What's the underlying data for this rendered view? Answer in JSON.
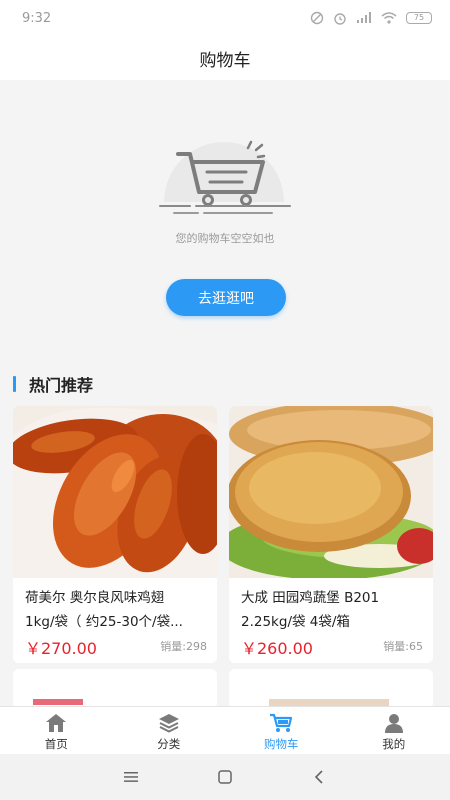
{
  "status_bar": {
    "time": "9:32",
    "battery_level": "75"
  },
  "header": {
    "title": "购物车"
  },
  "empty_cart": {
    "message": "您的购物车空空如也",
    "button_label": "去逛逛吧"
  },
  "recommend": {
    "title": "热门推荐",
    "products": [
      {
        "name_line1": "荷美尔 奥尔良风味鸡翅",
        "name_line2": "1kg/袋（ 约25-30个/袋...",
        "price": "￥270.00",
        "sales": "销量:298",
        "image": "roasted-chicken-wings-photo"
      },
      {
        "name_line1": "大成 田园鸡蔬堡 B201",
        "name_line2": "2.25kg/袋 4袋/箱",
        "price": "￥260.00",
        "sales": "销量:65",
        "image": "chicken-burger-photo"
      }
    ]
  },
  "tab_bar": {
    "tabs": [
      {
        "label": "首页",
        "icon": "home-icon",
        "active": false
      },
      {
        "label": "分类",
        "icon": "layers-icon",
        "active": false
      },
      {
        "label": "购物车",
        "icon": "cart-icon",
        "active": true
      },
      {
        "label": "我的",
        "icon": "user-icon",
        "active": false
      }
    ]
  },
  "colors": {
    "accent": "#2c9af4",
    "price": "#e8222d",
    "background": "#f4f4f4"
  }
}
